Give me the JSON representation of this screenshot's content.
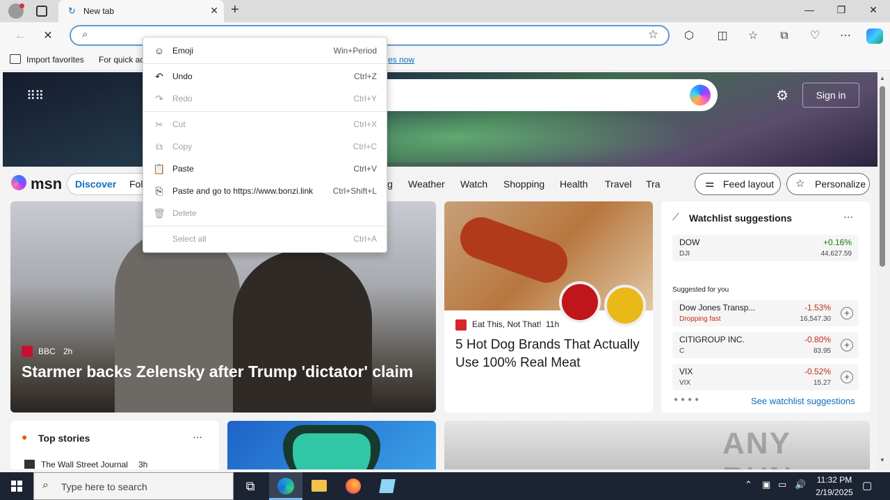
{
  "browser": {
    "tab_title": "New tab",
    "favorites": {
      "import_label": "Import favorites",
      "quick_text": "For quick ac",
      "link_text": "es now"
    }
  },
  "context_menu": {
    "items": [
      {
        "label": "Emoji",
        "shortcut": "Win+Period",
        "icon": "smiley-icon"
      },
      {
        "label": "Undo",
        "shortcut": "Ctrl+Z",
        "icon": "undo-icon"
      },
      {
        "label": "Redo",
        "shortcut": "Ctrl+Y",
        "icon": "redo-icon",
        "disabled": true
      },
      {
        "label": "Cut",
        "shortcut": "Ctrl+X",
        "icon": "scissors-icon",
        "disabled": true
      },
      {
        "label": "Copy",
        "shortcut": "Ctrl+C",
        "icon": "copy-icon",
        "disabled": true
      },
      {
        "label": "Paste",
        "shortcut": "Ctrl+V",
        "icon": "clipboard-icon"
      },
      {
        "label": "Paste and go to https://www.bonzi.link",
        "shortcut": "Ctrl+Shift+L",
        "icon": "paste-go-icon"
      },
      {
        "label": "Delete",
        "shortcut": "",
        "icon": "trash-icon",
        "disabled": true
      },
      {
        "label": "Select all",
        "shortcut": "Ctrl+A",
        "icon": "",
        "disabled": true
      }
    ]
  },
  "msn": {
    "logo": "msn",
    "signin": "Sign in",
    "nav": [
      "Discover",
      "Fol",
      "g",
      "Weather",
      "Watch",
      "Shopping",
      "Health",
      "Travel",
      "Tra"
    ],
    "feed_layout": "Feed layout",
    "personalize": "Personalize"
  },
  "hero_story": {
    "source": "BBC",
    "age": "2h",
    "headline": "Starmer backs Zelensky after Trump 'dictator' claim"
  },
  "food_story": {
    "source": "Eat This, Not That!",
    "age": "11h",
    "headline": "5 Hot Dog Brands That Actually Use 100% Real Meat"
  },
  "watchlist": {
    "title": "Watchlist suggestions",
    "dow": {
      "name": "DOW",
      "symbol": "DJI",
      "change": "+0.16%",
      "value": "44,627.59"
    },
    "suggested_label": "Suggested for you",
    "rows": [
      {
        "name": "Dow Jones Transp...",
        "symbol": "Dropping fast",
        "change": "-1.53%",
        "value": "16,547.30"
      },
      {
        "name": "CITIGROUP INC.",
        "symbol": "C",
        "change": "-0.80%",
        "value": "83.95"
      },
      {
        "name": "VIX",
        "symbol": "VIX",
        "change": "-0.52%",
        "value": "15.27"
      }
    ],
    "see_link": "See watchlist suggestions"
  },
  "top_stories": {
    "title": "Top stories",
    "source": "The Wall Street Journal",
    "age": "3h"
  },
  "watermark": "ANY RUN",
  "taskbar": {
    "search_placeholder": "Type here to search",
    "time": "11:32 PM",
    "date": "2/19/2025"
  },
  "colors": {
    "accent": "#0f6cbd",
    "negative": "#c42b1c",
    "positive": "#0e7a0d",
    "taskbar": "#1c2433"
  }
}
